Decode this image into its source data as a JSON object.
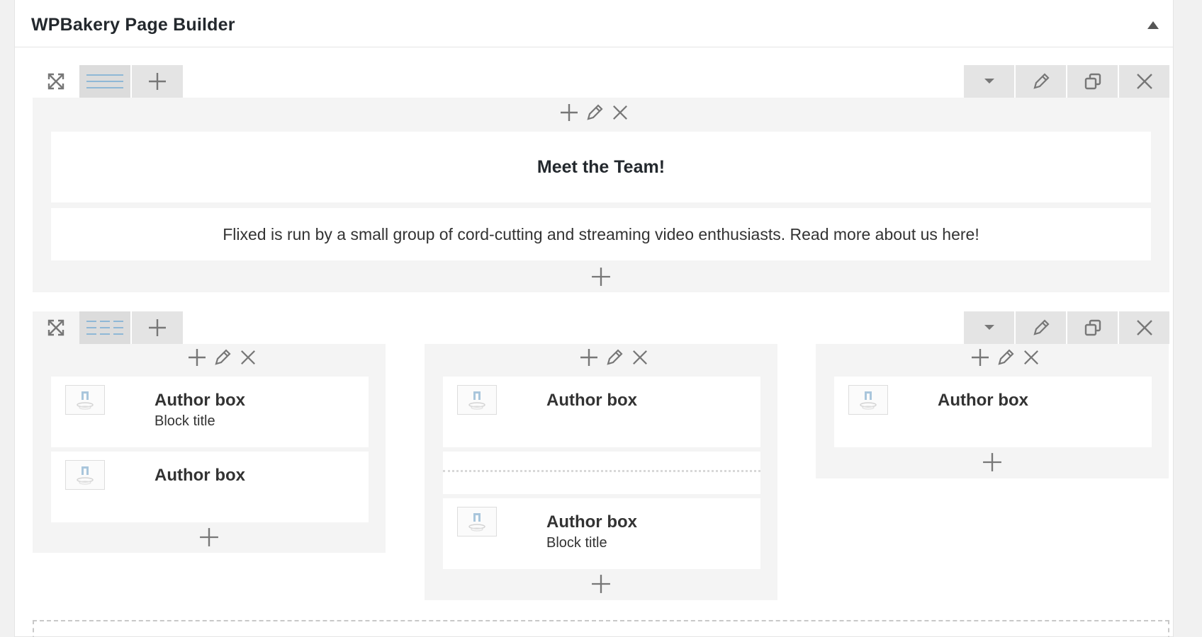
{
  "panel": {
    "title": "WPBakery Page Builder"
  },
  "row1": {
    "heading": "Meet the Team!",
    "text": "Flixed is run by a small group of cord-cutting and streaming video enthusiasts. Read more about us here!"
  },
  "row2": {
    "columns": [
      {
        "elements": [
          {
            "title": "Author box",
            "subtitle": "Block title"
          },
          {
            "title": "Author box",
            "subtitle": ""
          }
        ]
      },
      {
        "elements": [
          {
            "title": "Author box",
            "subtitle": ""
          },
          {
            "title": "Author box",
            "subtitle": "Block title"
          }
        ]
      },
      {
        "elements": [
          {
            "title": "Author box",
            "subtitle": ""
          }
        ]
      }
    ]
  },
  "colors": {
    "layout_icon": "#8fb8d6",
    "icon_gray": "#777777",
    "row_bg": "#f4f4f4",
    "control_bg": "#e4e4e4"
  },
  "icons": {
    "move": "arrows-expand-icon",
    "layout": "column-layout-icon",
    "add": "plus-icon",
    "toggle": "caret-down-icon",
    "edit": "pencil-icon",
    "clone": "duplicate-icon",
    "delete": "close-icon",
    "author_thumb": "author-image-icon"
  }
}
